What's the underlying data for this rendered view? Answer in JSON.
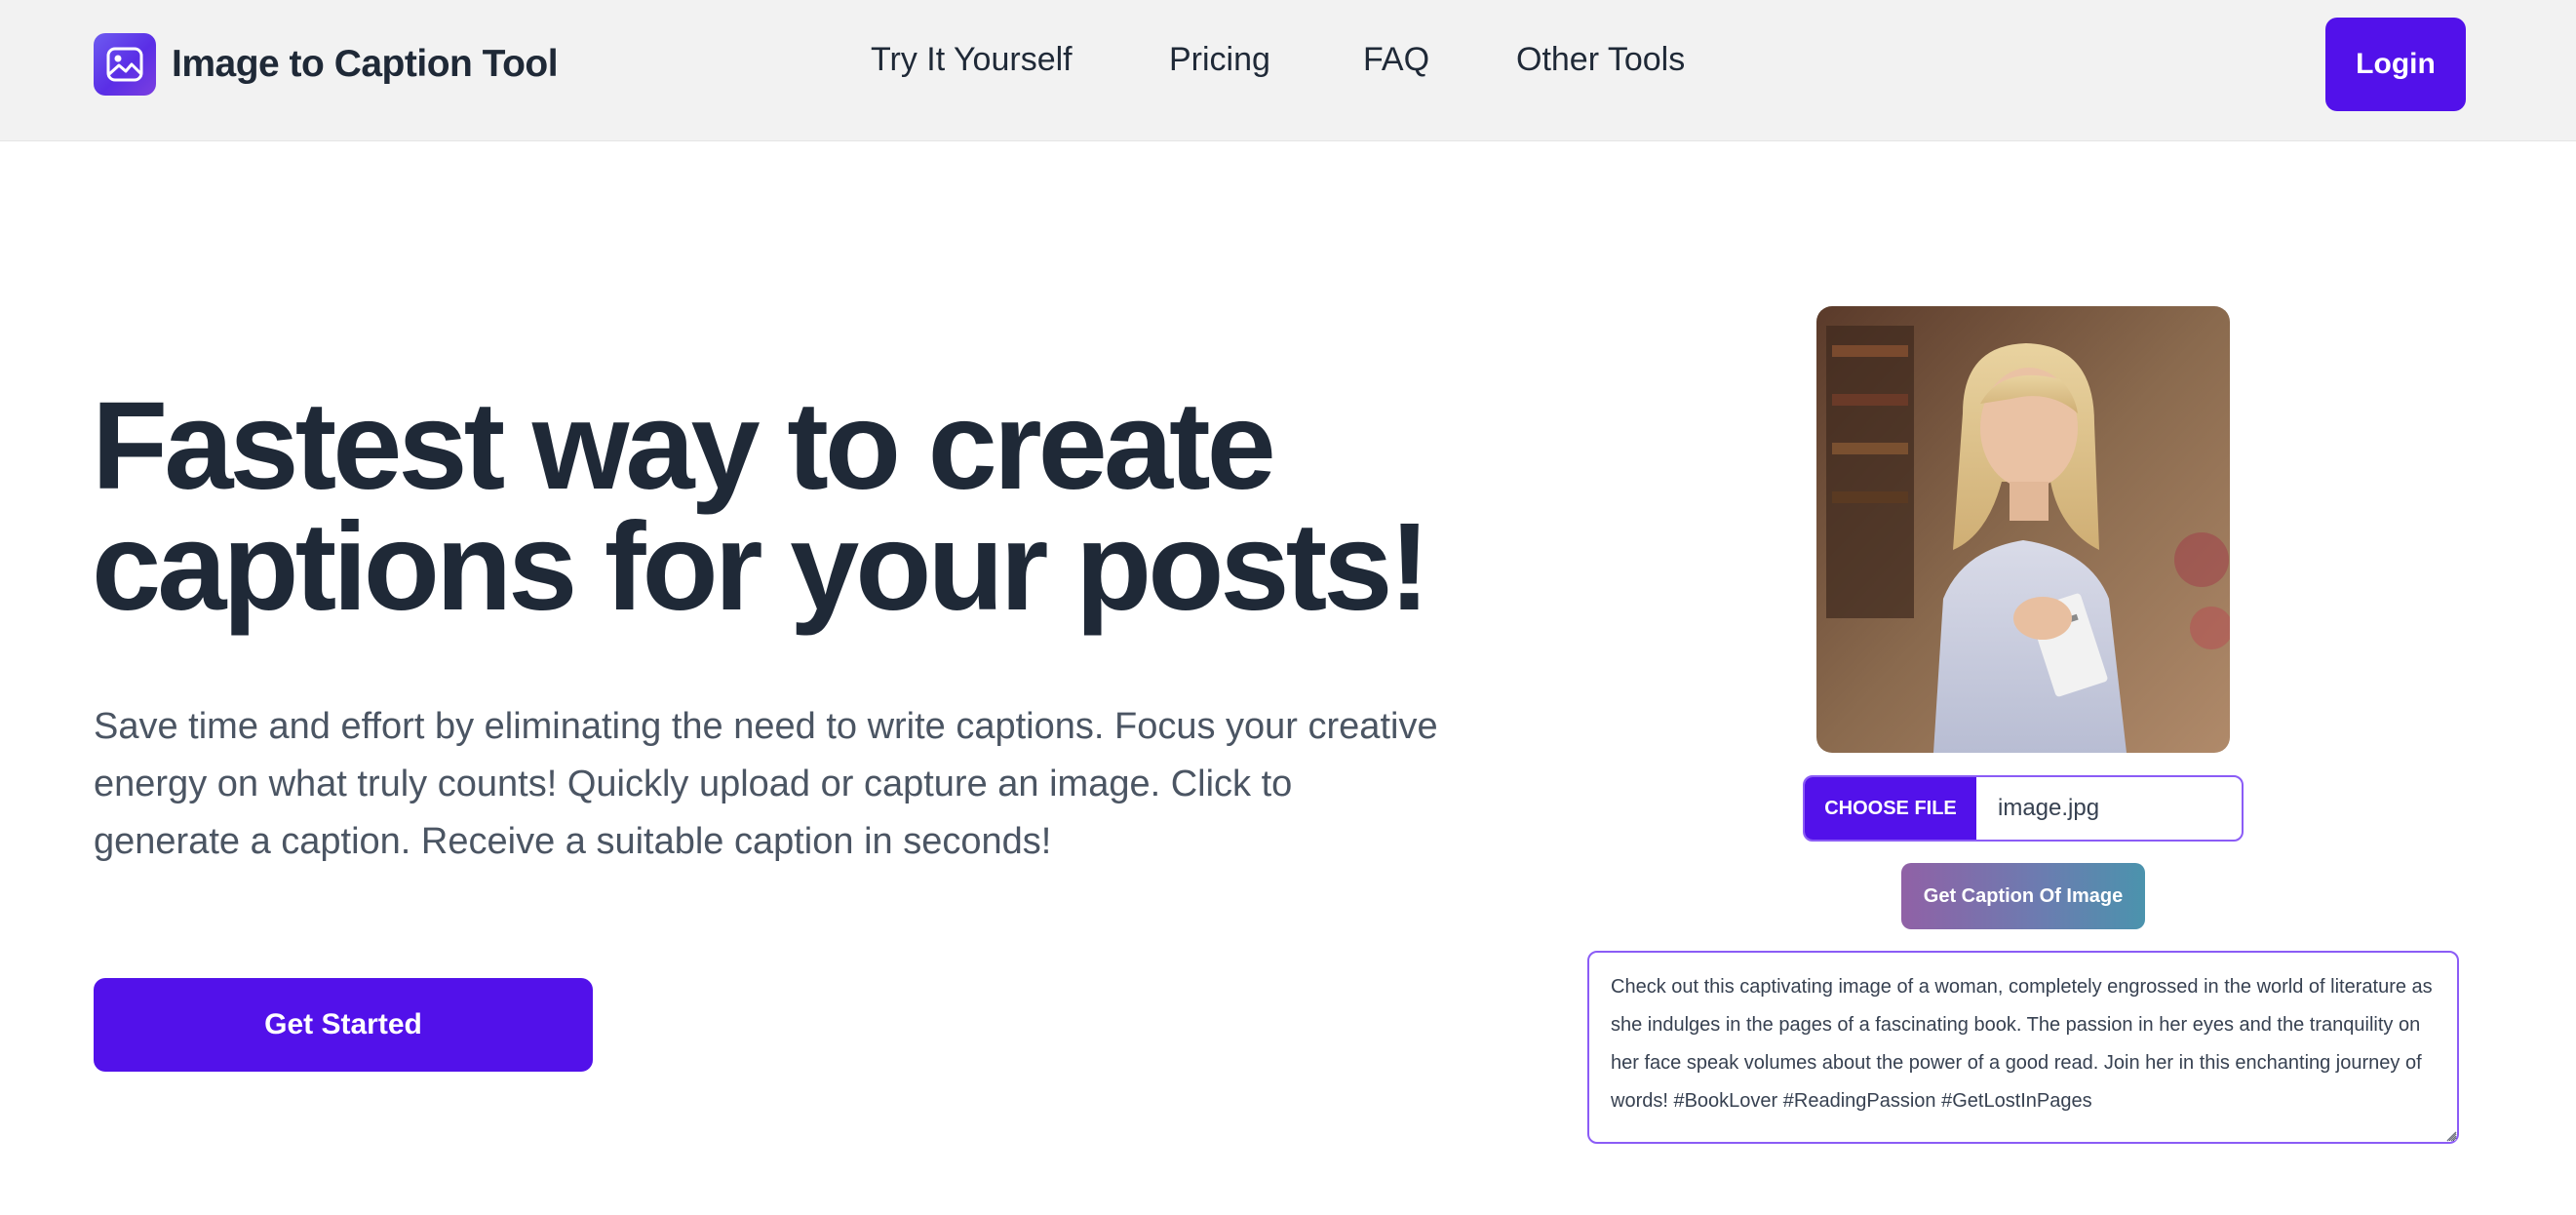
{
  "header": {
    "brand_name": "Image to Caption Tool",
    "brand_icon": "image-icon",
    "nav": [
      {
        "label": "Try It Yourself"
      },
      {
        "label": "Pricing"
      },
      {
        "label": "FAQ"
      },
      {
        "label": "Other Tools"
      }
    ],
    "login_label": "Login"
  },
  "hero": {
    "title": "Fastest way to create captions for your posts!",
    "subtitle": "Save time and effort by eliminating the need to write captions. Focus your creative energy on what truly counts! Quickly upload or capture an image. Click to generate a caption. Receive a suitable caption in seconds!",
    "cta_label": "Get Started"
  },
  "tool": {
    "choose_file_label": "CHOOSE FILE",
    "file_name": "image.jpg",
    "generate_label": "Get Caption Of Image",
    "caption_text": "Check out this captivating image of a woman, completely engrossed in the world of literature as she indulges in the pages of a fascinating book. The passion in her eyes and the tranquility on her face speak volumes about the power of a good read. Join her in this enchanting journey of words! #BookLover #ReadingPassion #GetLostInPages"
  },
  "colors": {
    "primary": "#5211ea",
    "heading": "#1f2937",
    "body_text": "#4b5563",
    "nav_bg": "#f2f2f2",
    "input_border": "#8b5cf6"
  }
}
